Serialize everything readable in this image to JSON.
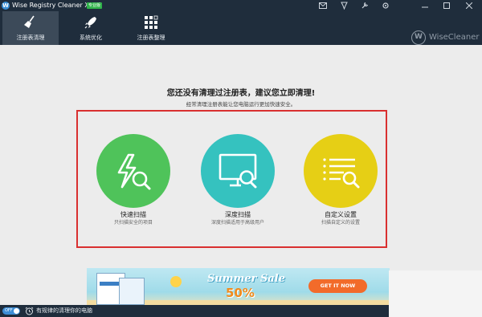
{
  "window": {
    "app_title": "Wise Registry Cleaner X",
    "edition_badge": "专业版",
    "app_icon_letter": "W",
    "controls": [
      "mail-icon",
      "skin-icon",
      "tools-icon",
      "settings-icon",
      "minimize-icon",
      "maximize-icon",
      "close-icon"
    ]
  },
  "nav": {
    "tabs": [
      {
        "label": "注册表清理",
        "icon": "broom-icon",
        "active": true
      },
      {
        "label": "系统优化",
        "icon": "rocket-icon",
        "active": false
      },
      {
        "label": "注册表整理",
        "icon": "blocks-icon",
        "active": false
      }
    ],
    "brand_logo": "W",
    "brand_name": "WiseCleaner"
  },
  "main": {
    "headline": "您还没有清理过注册表，建议您立即清理!",
    "subline": "经常清理注册表能让您电脑运行更加快速安全。",
    "options": [
      {
        "title": "快速扫描",
        "desc": "只扫描安全的项目",
        "color": "#4fc35a",
        "icon": "quick-scan-icon"
      },
      {
        "title": "深度扫描",
        "desc": "深度扫描适用于高级用户",
        "color": "#35c2bf",
        "icon": "deep-scan-icon"
      },
      {
        "title": "自定义设置",
        "desc": "扫描自定义的设置",
        "color": "#e6cf15",
        "icon": "custom-settings-icon"
      }
    ]
  },
  "banner": {
    "sale_text": "Summer Sale",
    "percent": "50%",
    "button_label": "GET IT NOW"
  },
  "status": {
    "toggle_label": "OFF",
    "schedule_text": "有规律的清理你的电脑"
  },
  "colors": {
    "titlebar": "#1f2d3c",
    "active_tab": "#3c4a59",
    "highlight": "#d93030"
  }
}
